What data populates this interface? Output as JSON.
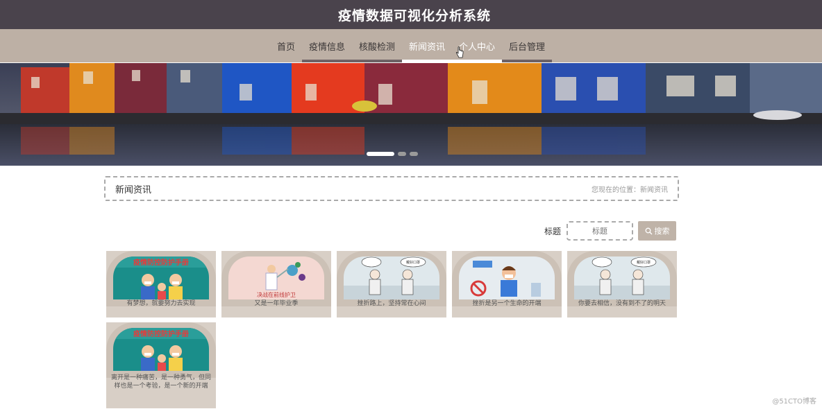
{
  "header": {
    "title": "疫情数据可视化分析系统"
  },
  "nav": {
    "items": [
      {
        "label": "首页"
      },
      {
        "label": "疫情信息"
      },
      {
        "label": "核酸检测"
      },
      {
        "label": "新闻资讯"
      },
      {
        "label": "个人中心"
      },
      {
        "label": "后台管理"
      }
    ],
    "active_index": 3
  },
  "carousel": {
    "slide_count": 4,
    "active_slide": 1
  },
  "breadcrumb": {
    "section": "新闻资讯",
    "location": "您现在的位置：新闻资讯"
  },
  "search": {
    "label": "标题",
    "placeholder": "标题",
    "button_label": "搜索",
    "button_icon": "search-icon"
  },
  "news": [
    {
      "caption": "有梦想，就要努力去实现",
      "image": "family-mask-poster",
      "poster_text": "疫情防控防护手册"
    },
    {
      "caption": "又是一年毕业季",
      "image": "doctor-fighting-virus",
      "poster_text": "决战在前线护卫"
    },
    {
      "caption": "挫折路上，坚持常在心间",
      "image": "elderly-couple-comic",
      "poster_text": "戴好口罩"
    },
    {
      "caption": "挫折是另一个生命的开端",
      "image": "man-with-mask-comic",
      "poster_text": ""
    },
    {
      "caption": "你要去相信，没有到不了的明天",
      "image": "elderly-couple-comic",
      "poster_text": "戴好口罩"
    },
    {
      "caption": "离开是一种痛苦，是一种勇气，但同样也是一个考验，是一个新的开端",
      "image": "family-mask-poster",
      "poster_text": "疫情防控防护手册"
    }
  ],
  "watermark": "@51CTO博客",
  "colors": {
    "header_bg": "#4a434c",
    "nav_bg": "#bdb0a5",
    "accent": "#bfb3a8",
    "card_bg": "#d8cfc6"
  }
}
